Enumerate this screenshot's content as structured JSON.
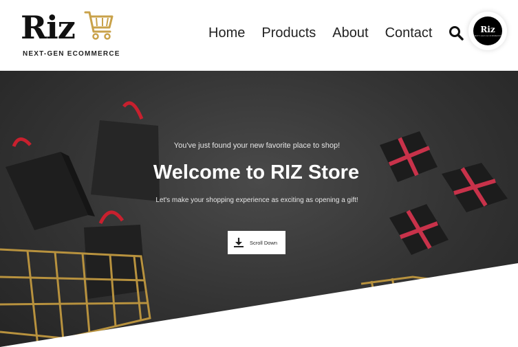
{
  "brand": {
    "name": "Riz",
    "tagline": "NEXT-GEN ECOMMERCE",
    "accent_color": "#c9a24a"
  },
  "nav": {
    "items": [
      {
        "label": "Home"
      },
      {
        "label": "Products"
      },
      {
        "label": "About"
      },
      {
        "label": "Contact"
      }
    ]
  },
  "header": {
    "search_icon": "search-icon",
    "avatar_text": "Riz",
    "avatar_sub": "NEXT-GEN ECOMMERCE"
  },
  "hero": {
    "pretitle": "You've just found your new favorite place to shop!",
    "title": "Welcome to RIZ Store",
    "subtitle": "Let's make your shopping experience as exciting as opening a gift!",
    "scroll_button_label": "Scroll Down",
    "scroll_icon": "download-icon"
  },
  "colors": {
    "hero_background": "#333333",
    "gift_ribbon": "#c8324a",
    "cart_gold": "#c9a24a"
  }
}
